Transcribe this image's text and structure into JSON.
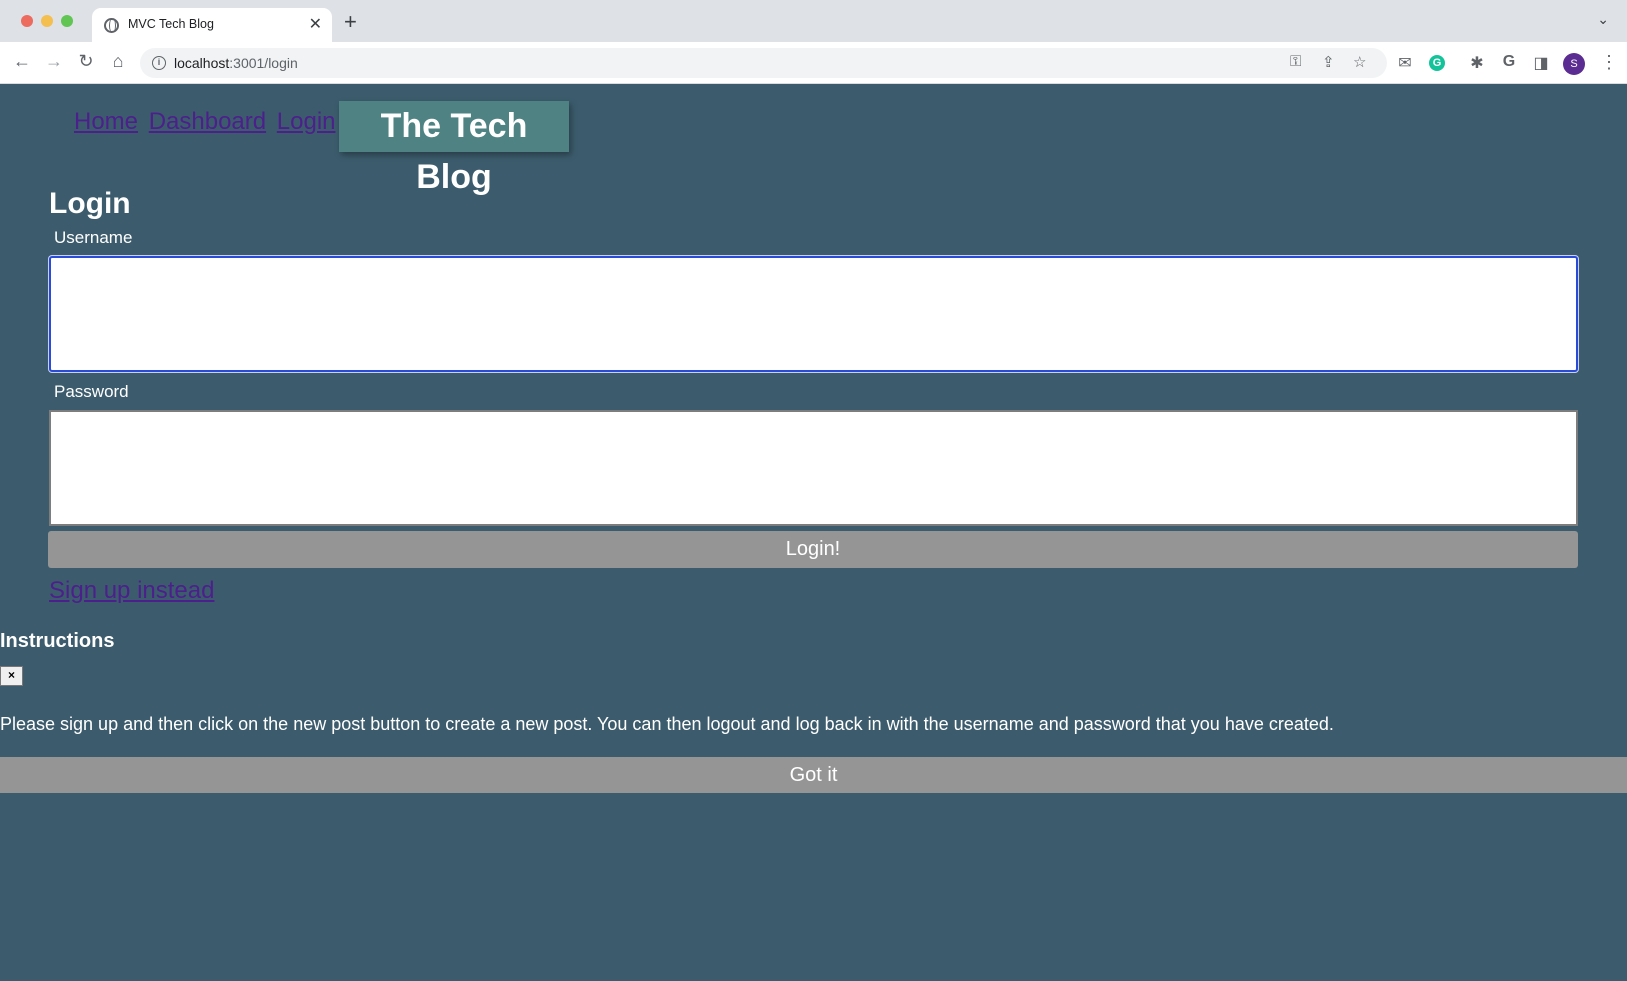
{
  "browser": {
    "tab_title": "MVC Tech Blog",
    "tab_close": "✕",
    "new_tab": "+",
    "url_host": "localhost",
    "url_path": ":3001/login",
    "avatar_letter": "S"
  },
  "nav": {
    "home": "Home",
    "dashboard": "Dashboard",
    "login": "Login",
    "brand": "The Tech Blog"
  },
  "login_form": {
    "title": "Login",
    "username_label": "Username",
    "username_value": "",
    "password_label": "Password",
    "password_value": "",
    "submit": "Login!",
    "signup_link": "Sign up instead"
  },
  "instructions": {
    "title": "Instructions",
    "close": "×",
    "text": "Please sign up and then click on the new post button to create a new post. You can then logout and log back in with the username and password that you have created.",
    "button": "Got it"
  },
  "colors": {
    "page_background": "#3c5c6d",
    "brand_background": "#4e8283",
    "button_gray": "#959595",
    "link_purple": "#4d1f8c",
    "focus_blue": "#2a4bd7"
  }
}
